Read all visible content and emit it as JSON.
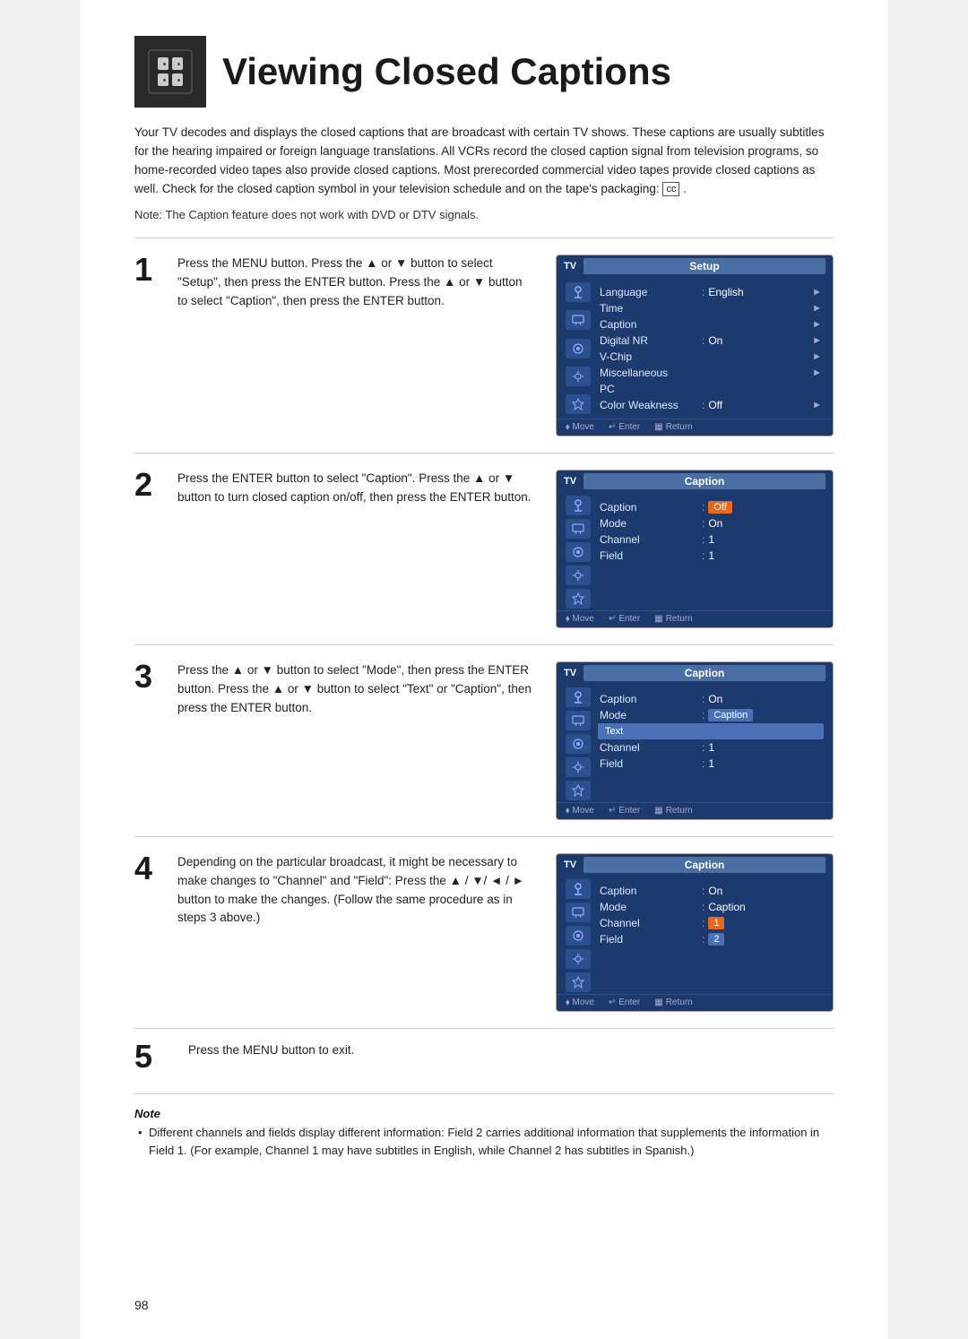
{
  "page": {
    "title": "Viewing Closed Captions",
    "number": "98"
  },
  "intro": {
    "paragraph": "Your TV decodes and displays the closed captions that are broadcast with certain TV shows. These captions are usually subtitles for the hearing impaired or foreign language translations. All VCRs record the closed caption signal from television programs, so home-recorded video tapes also provide closed captions. Most prerecorded commercial video tapes provide closed captions as well. Check for the closed caption symbol in your television schedule and on the tape's packaging:",
    "cc_symbol": "cc",
    "note": "Note: The Caption feature does not work with DVD or DTV signals."
  },
  "steps": [
    {
      "number": "1",
      "text": "Press the MENU button. Press the ▲ or ▼ button to select \"Setup\", then press the ENTER button. Press the ▲ or ▼ button to select \"Caption\", then press the ENTER button.",
      "panel": {
        "tv_label": "TV",
        "title": "Setup",
        "rows": [
          {
            "label": "Language",
            "sep": ":",
            "value": "English",
            "arrow": "►",
            "highlight": false
          },
          {
            "label": "Time",
            "sep": "",
            "value": "",
            "arrow": "►",
            "highlight": false
          },
          {
            "label": "Caption",
            "sep": "",
            "value": "",
            "arrow": "►",
            "highlight": false
          },
          {
            "label": "Digital NR",
            "sep": ":",
            "value": "On",
            "arrow": "►",
            "highlight": false
          },
          {
            "label": "V-Chip",
            "sep": "",
            "value": "",
            "arrow": "►",
            "highlight": false
          },
          {
            "label": "Miscellaneous",
            "sep": "",
            "value": "",
            "arrow": "►",
            "highlight": false
          },
          {
            "label": "PC",
            "sep": "",
            "value": "",
            "arrow": "",
            "highlight": false
          },
          {
            "label": "Color Weakness",
            "sep": ":",
            "value": "Off",
            "arrow": "►",
            "highlight": false
          }
        ],
        "footer": [
          {
            "icon": "⬧",
            "label": "Move"
          },
          {
            "icon": "↵",
            "label": "Enter"
          },
          {
            "icon": "▦",
            "label": "Return"
          }
        ]
      }
    },
    {
      "number": "2",
      "text": "Press the ENTER button to select \"Caption\". Press the ▲ or ▼ button to turn closed caption on/off, then press the ENTER button.",
      "panel": {
        "tv_label": "TV",
        "title": "Caption",
        "rows": [
          {
            "label": "Caption",
            "sep": ":",
            "value": "Off",
            "value_type": "orange",
            "arrow": "",
            "highlight": false
          },
          {
            "label": "Mode",
            "sep": ":",
            "value": "On",
            "value_type": "",
            "arrow": "",
            "highlight": false
          },
          {
            "label": "Channel",
            "sep": ":",
            "value": "1",
            "value_type": "",
            "arrow": "",
            "highlight": false
          },
          {
            "label": "Field",
            "sep": ":",
            "value": "1",
            "value_type": "",
            "arrow": "",
            "highlight": false
          }
        ],
        "footer": [
          {
            "icon": "⬧",
            "label": "Move"
          },
          {
            "icon": "↵",
            "label": "Enter"
          },
          {
            "icon": "▦",
            "label": "Return"
          }
        ]
      }
    },
    {
      "number": "3",
      "text": "Press the ▲ or ▼ button to select \"Mode\", then press the ENTER button. Press the ▲ or ▼ button to select \"Text\" or \"Caption\", then press the ENTER button.",
      "panel": {
        "tv_label": "TV",
        "title": "Caption",
        "rows": [
          {
            "label": "Caption",
            "sep": ":",
            "value": "On",
            "value_type": "",
            "arrow": "",
            "highlight": false
          },
          {
            "label": "Mode",
            "sep": ":",
            "value": "Caption",
            "value_type": "blue",
            "arrow": "",
            "highlight": false
          },
          {
            "label": "",
            "sep": "",
            "value": "Text",
            "value_type": "blue_sub",
            "arrow": "",
            "highlight": true
          },
          {
            "label": "Channel",
            "sep": ":",
            "value": "1",
            "value_type": "",
            "arrow": "",
            "highlight": false
          },
          {
            "label": "Field",
            "sep": ":",
            "value": "1",
            "value_type": "",
            "arrow": "",
            "highlight": false
          }
        ],
        "footer": [
          {
            "icon": "⬧",
            "label": "Move"
          },
          {
            "icon": "↵",
            "label": "Enter"
          },
          {
            "icon": "▦",
            "label": "Return"
          }
        ]
      }
    },
    {
      "number": "4",
      "text": "Depending on the particular broadcast, it might be necessary to make changes to \"Channel\" and \"Field\": Press the ▲ / ▼/ ◄ / ► button to make the changes. (Follow the same procedure as in steps 3 above.)",
      "panel": {
        "tv_label": "TV",
        "title": "Caption",
        "rows": [
          {
            "label": "Caption",
            "sep": ":",
            "value": "On",
            "value_type": "",
            "arrow": "",
            "highlight": false
          },
          {
            "label": "Mode",
            "sep": ":",
            "value": "Caption",
            "value_type": "",
            "arrow": "",
            "highlight": false
          },
          {
            "label": "Channel",
            "sep": ":",
            "value": "1",
            "value_type": "orange",
            "arrow": "",
            "highlight": false
          },
          {
            "label": "Field",
            "sep": ":",
            "value": "2",
            "value_type": "blue",
            "arrow": "",
            "highlight": false
          }
        ],
        "footer": [
          {
            "icon": "⬧",
            "label": "Move"
          },
          {
            "icon": "↵",
            "label": "Enter"
          },
          {
            "icon": "▦",
            "label": "Return"
          }
        ]
      }
    }
  ],
  "step5": {
    "number": "5",
    "text": "Press the MENU button to exit."
  },
  "note": {
    "title": "Note",
    "bullets": [
      "Different channels and fields display different information: Field 2 carries additional information that supplements the information in Field 1. (For example, Channel 1 may have subtitles in English, while Channel 2 has subtitles in Spanish.)"
    ]
  }
}
